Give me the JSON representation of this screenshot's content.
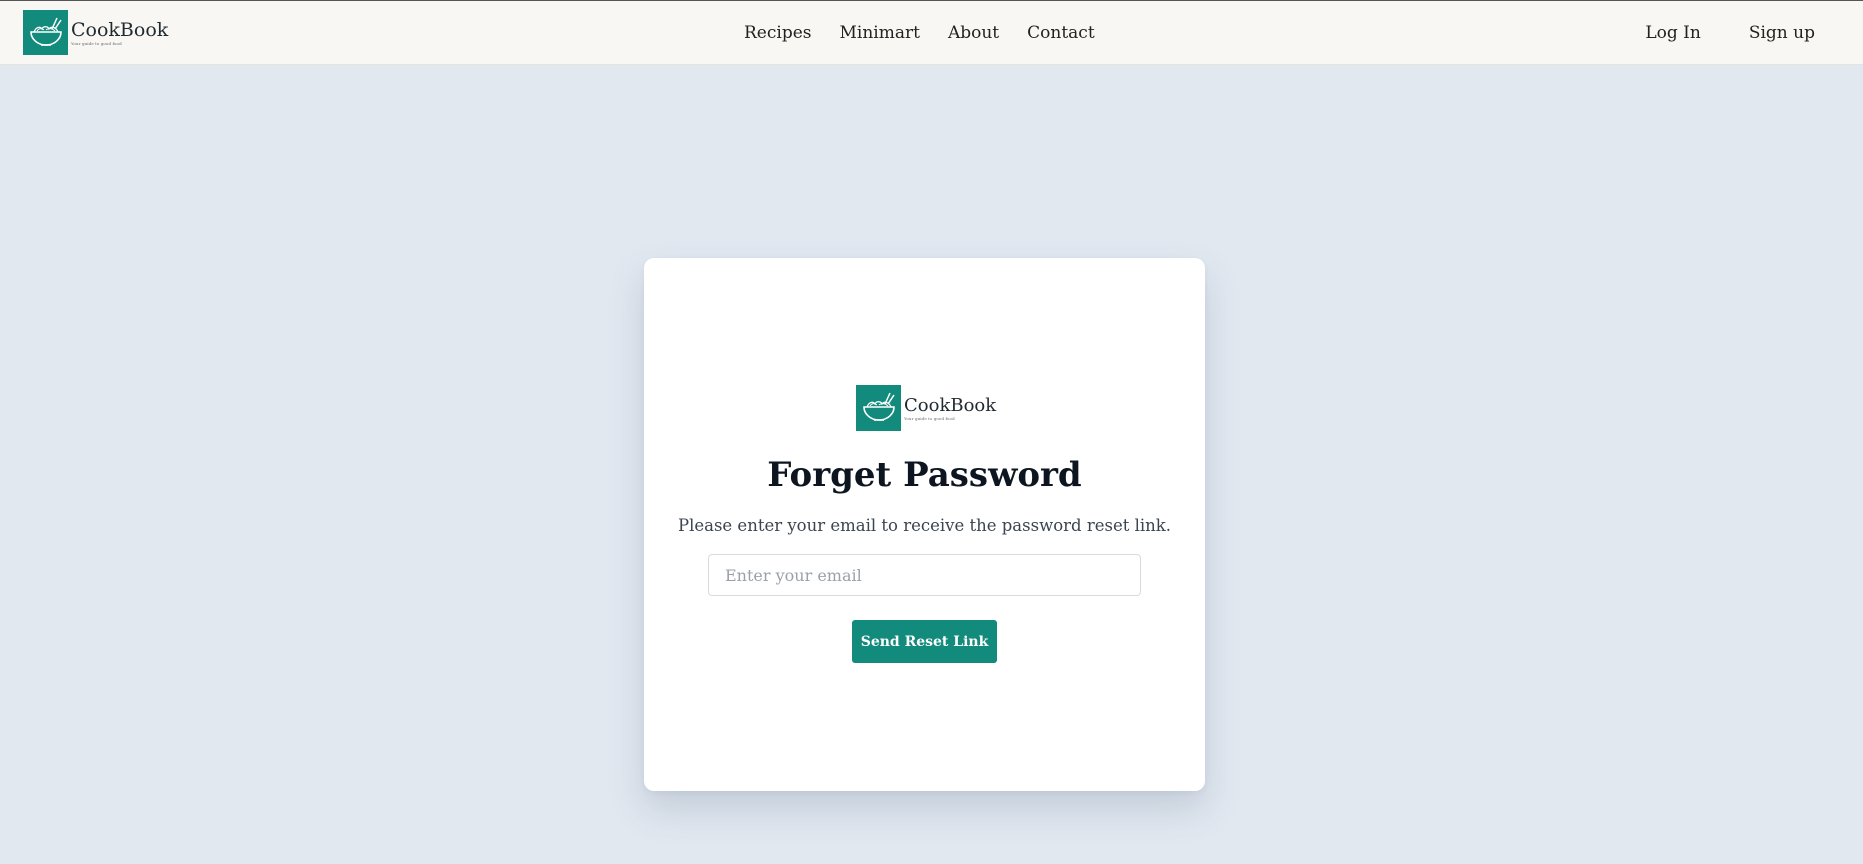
{
  "brand": {
    "name": "CookBook",
    "tagline": "Your guide to good food"
  },
  "nav": {
    "links": [
      {
        "label": "Recipes"
      },
      {
        "label": "Minimart"
      },
      {
        "label": "About"
      },
      {
        "label": "Contact"
      }
    ],
    "login_label": "Log In",
    "signup_label": "Sign up"
  },
  "card": {
    "title": "Forget Password",
    "subtitle": "Please enter your email to receive the password reset link.",
    "email_placeholder": "Enter your email",
    "email_value": "",
    "button_label": "Send Reset Link"
  },
  "colors": {
    "accent": "#128a7c",
    "background": "#e1e8f0",
    "navbar": "#f8f7f3"
  },
  "icons": {
    "logo": "bowl-with-chopsticks-icon"
  }
}
